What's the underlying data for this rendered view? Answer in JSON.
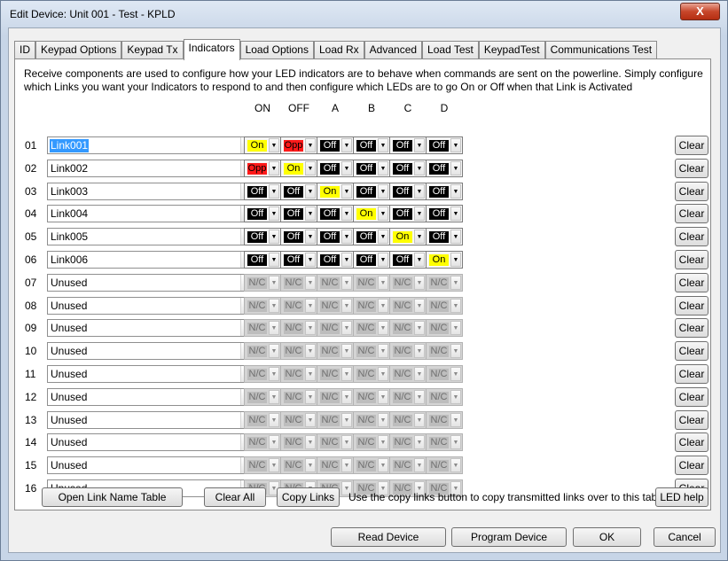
{
  "window": {
    "title": "Edit Device: Unit 001 - Test - KPLD",
    "close_label": "X"
  },
  "tabs": [
    "ID",
    "Keypad Options",
    "Keypad Tx",
    "Indicators",
    "Load Options",
    "Load Rx",
    "Advanced",
    "Load Test",
    "KeypadTest",
    "Communications Test"
  ],
  "active_tab": "Indicators",
  "description": "Receive components are used to configure how your LED indicators are to behave when commands are sent on the powerline.  Simply configure which Links you want your Indicators to respond to and then configure which LEDs are to go On or Off when that Link is Activated",
  "columns": [
    "ON",
    "OFF",
    "A",
    "B",
    "C",
    "D"
  ],
  "rows": [
    {
      "num": "01",
      "link": "Link001",
      "selected": true,
      "states": [
        "On",
        "Opp",
        "Off",
        "Off",
        "Off",
        "Off"
      ]
    },
    {
      "num": "02",
      "link": "Link002",
      "selected": false,
      "states": [
        "Opp",
        "On",
        "Off",
        "Off",
        "Off",
        "Off"
      ]
    },
    {
      "num": "03",
      "link": "Link003",
      "selected": false,
      "states": [
        "Off",
        "Off",
        "On",
        "Off",
        "Off",
        "Off"
      ]
    },
    {
      "num": "04",
      "link": "Link004",
      "selected": false,
      "states": [
        "Off",
        "Off",
        "Off",
        "On",
        "Off",
        "Off"
      ]
    },
    {
      "num": "05",
      "link": "Link005",
      "selected": false,
      "states": [
        "Off",
        "Off",
        "Off",
        "Off",
        "On",
        "Off"
      ]
    },
    {
      "num": "06",
      "link": "Link006",
      "selected": false,
      "states": [
        "Off",
        "Off",
        "Off",
        "Off",
        "Off",
        "On"
      ]
    },
    {
      "num": "07",
      "link": "Unused",
      "selected": false,
      "states": [
        "N/C",
        "N/C",
        "N/C",
        "N/C",
        "N/C",
        "N/C"
      ]
    },
    {
      "num": "08",
      "link": "Unused",
      "selected": false,
      "states": [
        "N/C",
        "N/C",
        "N/C",
        "N/C",
        "N/C",
        "N/C"
      ]
    },
    {
      "num": "09",
      "link": "Unused",
      "selected": false,
      "states": [
        "N/C",
        "N/C",
        "N/C",
        "N/C",
        "N/C",
        "N/C"
      ]
    },
    {
      "num": "10",
      "link": "Unused",
      "selected": false,
      "states": [
        "N/C",
        "N/C",
        "N/C",
        "N/C",
        "N/C",
        "N/C"
      ]
    },
    {
      "num": "11",
      "link": "Unused",
      "selected": false,
      "states": [
        "N/C",
        "N/C",
        "N/C",
        "N/C",
        "N/C",
        "N/C"
      ]
    },
    {
      "num": "12",
      "link": "Unused",
      "selected": false,
      "states": [
        "N/C",
        "N/C",
        "N/C",
        "N/C",
        "N/C",
        "N/C"
      ]
    },
    {
      "num": "13",
      "link": "Unused",
      "selected": false,
      "states": [
        "N/C",
        "N/C",
        "N/C",
        "N/C",
        "N/C",
        "N/C"
      ]
    },
    {
      "num": "14",
      "link": "Unused",
      "selected": false,
      "states": [
        "N/C",
        "N/C",
        "N/C",
        "N/C",
        "N/C",
        "N/C"
      ]
    },
    {
      "num": "15",
      "link": "Unused",
      "selected": false,
      "states": [
        "N/C",
        "N/C",
        "N/C",
        "N/C",
        "N/C",
        "N/C"
      ]
    },
    {
      "num": "16",
      "link": "Unused",
      "selected": false,
      "states": [
        "N/C",
        "N/C",
        "N/C",
        "N/C",
        "N/C",
        "N/C"
      ]
    }
  ],
  "row_clear_label": "Clear",
  "bottom": {
    "open_link_table": "Open Link Name Table",
    "clear_all": "Clear All",
    "copy_links": "Copy Links",
    "copy_note": "Use the copy links button to copy transmitted links over to this tab",
    "led_help": "LED help"
  },
  "footer": {
    "read_device": "Read Device",
    "program_device": "Program Device",
    "ok": "OK",
    "cancel": "Cancel"
  },
  "state_colors": {
    "On": "#ffff00",
    "Off": "#000000",
    "Opp": "#ff1a1a",
    "N/C": "#bdbdbd"
  },
  "icons": {
    "dropdown": "chevron-down-icon",
    "close": "close-icon"
  }
}
